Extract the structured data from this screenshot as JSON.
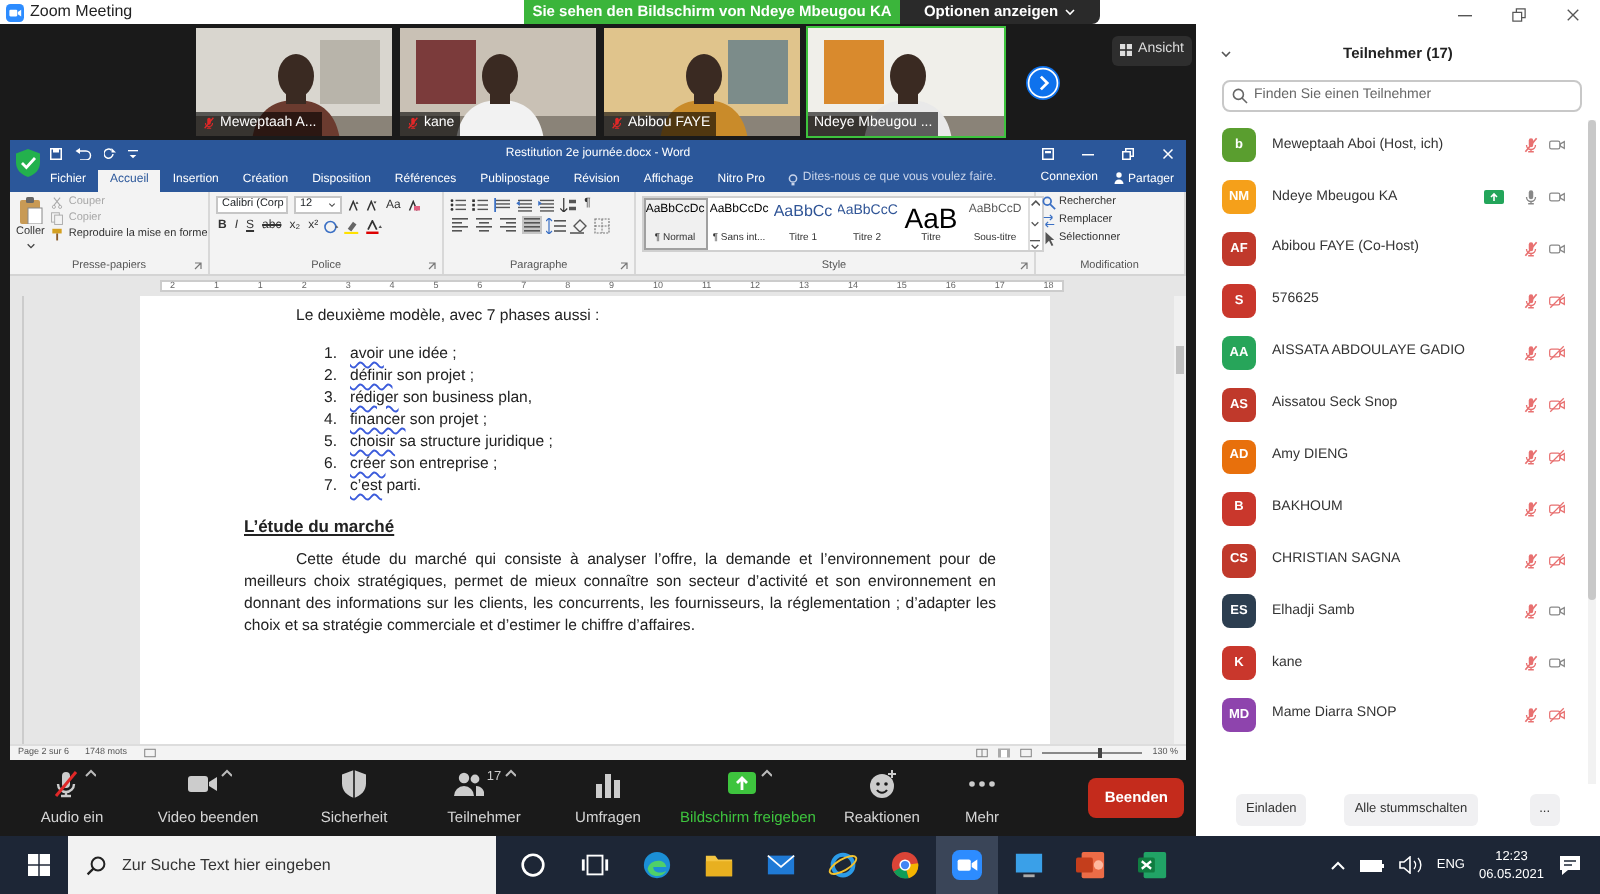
{
  "window": {
    "title": "Zoom Meeting"
  },
  "share_banner": {
    "text": "Sie sehen den Bildschirm von Ndeye Mbeugou KA",
    "options": "Optionen anzeigen"
  },
  "view_button": "Ansicht",
  "video_tiles": [
    {
      "name": "Meweptaah A...",
      "muted": true,
      "speaking": false
    },
    {
      "name": "kane",
      "muted": true,
      "speaking": false
    },
    {
      "name": "Abibou FAYE",
      "muted": true,
      "speaking": false
    },
    {
      "name": "Ndeye Mbeugou ...",
      "muted": false,
      "speaking": true
    }
  ],
  "word": {
    "title": "Restitution 2e journée.docx - Word",
    "tabs": [
      {
        "label": "Fichier",
        "selected": false
      },
      {
        "label": "Accueil",
        "selected": true
      },
      {
        "label": "Insertion",
        "selected": false
      },
      {
        "label": "Création",
        "selected": false
      },
      {
        "label": "Disposition",
        "selected": false
      },
      {
        "label": "Références",
        "selected": false
      },
      {
        "label": "Publipostage",
        "selected": false
      },
      {
        "label": "Révision",
        "selected": false
      },
      {
        "label": "Affichage",
        "selected": false
      },
      {
        "label": "Nitro Pro",
        "selected": false
      }
    ],
    "tell_me": "Dites-nous ce que vous voulez faire.",
    "sign_in": "Connexion",
    "share": "Partager",
    "clipboard": {
      "label": "Presse-papiers",
      "paste": "Coller",
      "actions": [
        {
          "kind": "cut",
          "label": "Couper",
          "disabled": true
        },
        {
          "kind": "copy",
          "label": "Copier",
          "disabled": true
        },
        {
          "kind": "painter",
          "label": "Reproduire la mise en forme",
          "disabled": false
        }
      ]
    },
    "font": {
      "label": "Police",
      "family": "Calibri (Corp",
      "size": "12",
      "change_case": "Aa",
      "format_buttons": [
        "B",
        "I",
        "S",
        "abc",
        "x₂",
        "x²"
      ]
    },
    "paragraph": {
      "label": "Paragraphe",
      "show_marks": "¶",
      "alignments": [
        {
          "kind": "left",
          "selected": false
        },
        {
          "kind": "center",
          "selected": false
        },
        {
          "kind": "right",
          "selected": false
        },
        {
          "kind": "justify",
          "selected": true
        }
      ]
    },
    "styles": {
      "label": "Style",
      "items": [
        {
          "sample": "AaBbCcDc",
          "name": "¶ Normal",
          "kind": "normal",
          "selected": true
        },
        {
          "sample": "AaBbCcDc",
          "name": "¶ Sans int...",
          "kind": "normal",
          "selected": false
        },
        {
          "sample": "AaBbCc",
          "name": "Titre 1",
          "kind": "heading1",
          "selected": false
        },
        {
          "sample": "AaBbCcC",
          "name": "Titre 2",
          "kind": "heading2",
          "selected": false
        },
        {
          "sample": "AaB",
          "name": "Titre",
          "kind": "title",
          "selected": false
        },
        {
          "sample": "AaBbCcD",
          "name": "Sous-titre",
          "kind": "subtitle",
          "selected": false
        }
      ]
    },
    "editing": {
      "label": "Modification",
      "items": [
        {
          "kind": "find",
          "label": "Rechercher"
        },
        {
          "kind": "replace",
          "label": "Remplacer"
        },
        {
          "kind": "select",
          "label": "Sélectionner"
        }
      ]
    },
    "ruler": [
      "2",
      "1",
      "1",
      "2",
      "3",
      "4",
      "5",
      "6",
      "7",
      "8",
      "9",
      "10",
      "11",
      "12",
      "13",
      "14",
      "15",
      "16",
      "17",
      "18"
    ],
    "document": {
      "intro": "Le deuxième modèle, avec 7 phases aussi :",
      "steps": [
        {
          "number": "1.",
          "word": "avoir",
          "rest": " une idée ;"
        },
        {
          "number": "2.",
          "word": "définir",
          "rest": " son projet ;"
        },
        {
          "number": "3.",
          "word": "rédiger",
          "rest": " son business plan,"
        },
        {
          "number": "4.",
          "word": "financer",
          "rest": " son projet ;"
        },
        {
          "number": "5.",
          "word": "choisir",
          "rest": " sa structure juridique ;"
        },
        {
          "number": "6.",
          "word": "créer",
          "rest": " son entreprise ;"
        },
        {
          "number": "7.",
          "word": "c’est",
          "rest": " parti."
        }
      ],
      "heading": "L’étude du marché",
      "paragraph": "Cette étude du marché qui consiste à analyser l’offre, la demande et l’environnement pour de meilleurs choix stratégiques, permet de mieux connaître son secteur d’activité et son environnement en donnant des informations sur les clients, les concurrents, les fournisseurs, la réglementation ; d’adapter les choix et sa stratégie commerciale et d’estimer le chiffre d’affaires."
    },
    "status": {
      "page": "Page 2 sur 6",
      "words": "1748 mots",
      "zoom": "130 %",
      "zoom_slider": {
        "level": 0.55
      }
    }
  },
  "toolbar": [
    {
      "kind": "audio",
      "label": "Audio ein",
      "muted": true
    },
    {
      "kind": "video",
      "label": "Video beenden"
    },
    {
      "kind": "security",
      "label": "Sicherheit"
    },
    {
      "kind": "participants",
      "label": "Teilnehmer",
      "count": "17"
    },
    {
      "kind": "polls",
      "label": "Umfragen"
    },
    {
      "kind": "share",
      "label": "Bildschirm freigeben"
    },
    {
      "kind": "reactions",
      "label": "Reaktionen"
    },
    {
      "kind": "more",
      "label": "Mehr"
    }
  ],
  "end_button": "Beenden",
  "participants": {
    "title": "Teilnehmer (17)",
    "search_placeholder": "Finden Sie einen Teilnehmer",
    "items": [
      {
        "initials": "b",
        "color": "#5a9e2f",
        "name": "Meweptaah Aboi (Host, ich)",
        "sharing": false,
        "muted": true,
        "video_off": false
      },
      {
        "initials": "NM",
        "color": "#f5a01a",
        "name": "Ndeye Mbeugou KA",
        "sharing": true,
        "muted": false,
        "video_off": false
      },
      {
        "initials": "AF",
        "color": "#c0392b",
        "name": "Abibou FAYE (Co-Host)",
        "sharing": false,
        "muted": true,
        "video_off": false
      },
      {
        "initials": "S",
        "color": "#c9372c",
        "name": "576625",
        "sharing": false,
        "muted": true,
        "video_off": true
      },
      {
        "initials": "AA",
        "color": "#27a55a",
        "name": "AISSATA ABDOULAYE GADIO",
        "sharing": false,
        "muted": true,
        "video_off": true
      },
      {
        "initials": "AS",
        "color": "#c0392b",
        "name": "Aissatou Seck Snop",
        "sharing": false,
        "muted": true,
        "video_off": true
      },
      {
        "initials": "AD",
        "color": "#e8700c",
        "name": "Amy DIENG",
        "sharing": false,
        "muted": true,
        "video_off": true
      },
      {
        "initials": "B",
        "color": "#c9372c",
        "name": "BAKHOUM",
        "sharing": false,
        "muted": true,
        "video_off": true
      },
      {
        "initials": "CS",
        "color": "#c0392b",
        "name": "CHRISTIAN SAGNA",
        "sharing": false,
        "muted": true,
        "video_off": true
      },
      {
        "initials": "ES",
        "color": "#2c3e50",
        "name": "Elhadji Samb",
        "sharing": false,
        "muted": true,
        "video_off": false
      },
      {
        "initials": "K",
        "color": "#c9372c",
        "name": "kane",
        "sharing": false,
        "muted": true,
        "video_off": false
      },
      {
        "initials": "MD",
        "color": "#8e44ad",
        "name": "Mame Diarra SNOP",
        "sharing": false,
        "muted": true,
        "video_off": true
      }
    ],
    "buttons": [
      "Einladen",
      "Alle stummschalten",
      "..."
    ]
  },
  "taskbar": {
    "search_placeholder": "Zur Suche Text hier eingeben",
    "apps": [
      {
        "kind": "cortana",
        "active": false
      },
      {
        "kind": "taskview",
        "active": false
      },
      {
        "kind": "edge",
        "active": false
      },
      {
        "kind": "explorer",
        "active": false
      },
      {
        "kind": "mail",
        "active": false
      },
      {
        "kind": "ie",
        "active": false
      },
      {
        "kind": "chrome",
        "active": false
      },
      {
        "kind": "zoom",
        "active": true
      },
      {
        "kind": "monitor",
        "active": false
      },
      {
        "kind": "powerpoint",
        "active": false
      },
      {
        "kind": "excel",
        "active": false
      }
    ],
    "language": "ENG",
    "time": "12:23",
    "date": "06.05.2021"
  }
}
